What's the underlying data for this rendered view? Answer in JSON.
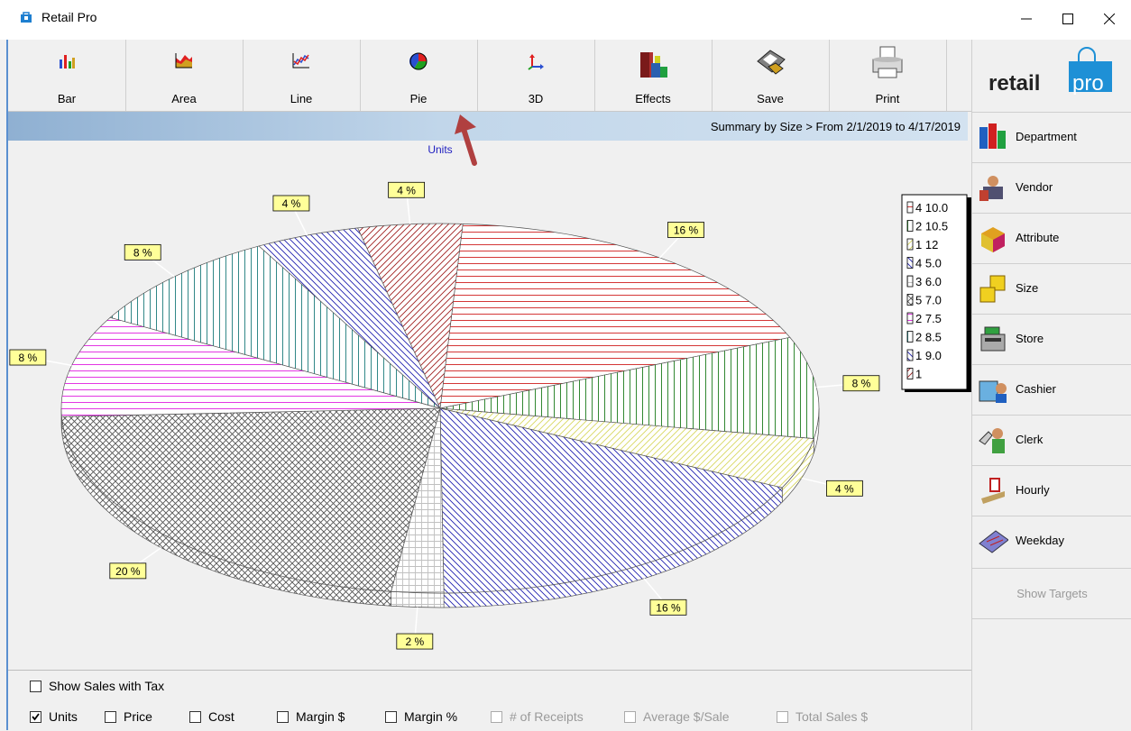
{
  "window": {
    "title": "Retail Pro",
    "minimize": "—",
    "maximize": "☐",
    "close": "✕"
  },
  "toolbar": {
    "buttons": [
      {
        "label": "Bar",
        "icon": "bar-chart-icon"
      },
      {
        "label": "Area",
        "icon": "area-chart-icon"
      },
      {
        "label": "Line",
        "icon": "line-chart-icon"
      },
      {
        "label": "Pie",
        "icon": "pie-chart-icon"
      },
      {
        "label": "3D",
        "icon": "3d-axes-icon"
      },
      {
        "label": "Effects",
        "icon": "effects-icon"
      },
      {
        "label": "Save",
        "icon": "save-icon"
      },
      {
        "label": "Print",
        "icon": "printer-icon"
      }
    ]
  },
  "banner": {
    "text": "Summary by Size > From 2/1/2019  to 4/17/2019"
  },
  "chart_data": {
    "type": "pie",
    "title": "Units",
    "legend_position": "right",
    "slices": [
      {
        "name": "4 10.0",
        "percent": 16,
        "label": "16 %",
        "color": "#d02020"
      },
      {
        "name": "2 10.5",
        "percent": 8,
        "label": "8 %",
        "color": "#1a7a1a"
      },
      {
        "name": "1 12",
        "percent": 4,
        "label": "4 %",
        "color": "#d8d860"
      },
      {
        "name": "4 5.0",
        "percent": 16,
        "label": "16 %",
        "color": "#2020b0"
      },
      {
        "name": "3 6.0",
        "percent": 2,
        "label": "2 %",
        "color": "#c0c0c0"
      },
      {
        "name": "5 7.0",
        "percent": 20,
        "label": "20 %",
        "color": "#555555"
      },
      {
        "name": "2 7.5",
        "percent": 8,
        "label": "8 %",
        "color": "#e020e0"
      },
      {
        "name": "2 8.5",
        "percent": 8,
        "label": "8 %",
        "color": "#1a7a7a"
      },
      {
        "name": "1 9.0",
        "percent": 4,
        "label": "4 %",
        "color": "#2020b0"
      },
      {
        "name": "1",
        "percent": 4,
        "label": "4 %",
        "color": "#a02020"
      }
    ]
  },
  "options": {
    "show_sales_with_tax": {
      "label": "Show Sales with Tax",
      "checked": false
    },
    "checkboxes": [
      {
        "label": "Units",
        "checked": true,
        "enabled": true
      },
      {
        "label": "Price",
        "checked": false,
        "enabled": true
      },
      {
        "label": "Cost",
        "checked": false,
        "enabled": true
      },
      {
        "label": "Margin $",
        "checked": false,
        "enabled": true
      },
      {
        "label": "Margin %",
        "checked": false,
        "enabled": true
      },
      {
        "label": "# of Receipts",
        "checked": false,
        "enabled": false
      },
      {
        "label": "Average $/Sale",
        "checked": false,
        "enabled": false
      },
      {
        "label": "Total Sales $",
        "checked": false,
        "enabled": false
      }
    ]
  },
  "sidebar": {
    "logo_text": {
      "retail": "retail",
      "pro": "pro"
    },
    "items": [
      {
        "label": "Department",
        "icon": "department-blocks-icon"
      },
      {
        "label": "Vendor",
        "icon": "vendor-icon"
      },
      {
        "label": "Attribute",
        "icon": "attribute-box-icon"
      },
      {
        "label": "Size",
        "icon": "size-cubes-icon"
      },
      {
        "label": "Store",
        "icon": "store-register-icon"
      },
      {
        "label": "Cashier",
        "icon": "cashier-icon"
      },
      {
        "label": "Clerk",
        "icon": "clerk-icon"
      },
      {
        "label": "Hourly",
        "icon": "hourly-timer-icon"
      },
      {
        "label": "Weekday",
        "icon": "weekday-calendar-icon"
      }
    ],
    "show_targets": "Show Targets"
  },
  "colors": {
    "banner_start": "#8fb0d2",
    "banner_end": "#d3e2f0",
    "label_bg": "#ffff99",
    "brand_blue": "#1e90d6"
  }
}
